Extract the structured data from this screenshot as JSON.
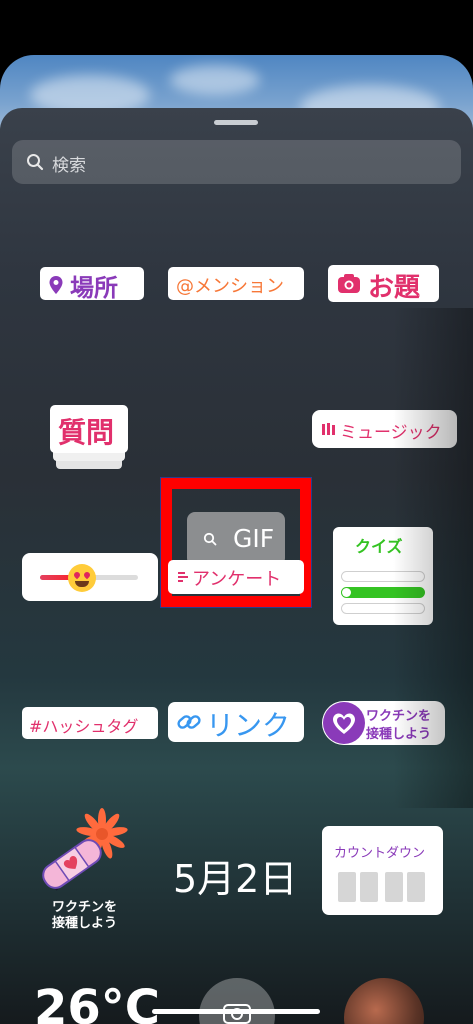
{
  "search": {
    "placeholder": "検索"
  },
  "stickers": {
    "location": "場所",
    "mention": "@メンション",
    "topic": "お題",
    "question": "質問",
    "gif": "GIF",
    "music": "ミュージック",
    "poll": "アンケート",
    "quiz": "クイズ",
    "hashtag": "#ハッシュタグ",
    "link": "リンク",
    "vaccine_line1": "ワクチンを",
    "vaccine_line2": "接種しよう",
    "vaccine2_line1": "ワクチンを",
    "vaccine2_line2": "接種しよう",
    "date": "5月2日",
    "countdown": "カウントダウン",
    "temperature": "26°C",
    "emoji_slider_value": 0.45
  },
  "colors": {
    "purple": "#8a3ab9",
    "orange": "#f77737",
    "magenta": "#e1306c",
    "pink": "#e4405f",
    "blue": "#3897f0",
    "highlight": "#ff0000",
    "quiz_green": "#34c322"
  },
  "icons": [
    "search-icon",
    "location-pin-icon",
    "camera-icon",
    "music-bars-icon",
    "link-icon",
    "heart-icon",
    "bandage-flower-icon",
    "camera-shutter-icon"
  ]
}
